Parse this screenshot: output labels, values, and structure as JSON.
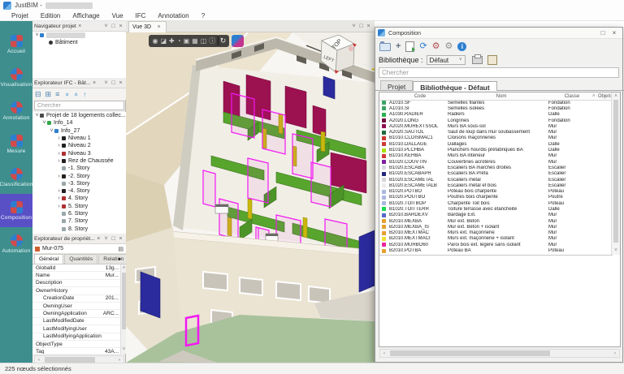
{
  "window": {
    "app_title": "JustBIM -",
    "menu": [
      "Projet",
      "Edition",
      "Affichage",
      "Vue",
      "IFC",
      "Annotation",
      "?"
    ]
  },
  "sidebar": {
    "items": [
      {
        "label": "Accueil",
        "cls": "",
        "icon_cls": ""
      },
      {
        "label": "Visualisation",
        "cls": "",
        "icon_cls": "round"
      },
      {
        "label": "Annotation",
        "cls": "",
        "icon_cls": "round"
      },
      {
        "label": "Mesure",
        "cls": "",
        "icon_cls": ""
      },
      {
        "label": "Classification",
        "cls": "",
        "icon_cls": "round"
      },
      {
        "label": "Composition",
        "cls": "active",
        "icon_cls": ""
      },
      {
        "label": "Automation",
        "cls": "",
        "icon_cls": "round"
      }
    ]
  },
  "navigator": {
    "title": "Navigateur projet",
    "close_glyph": "×",
    "root_chevron": "˅",
    "child_label": "Bâtiment"
  },
  "ifc": {
    "title": "Explorateur IFC - Bât...",
    "search_placeholder": "Chercher",
    "tree": [
      {
        "label": "Projet de 18 logements collec...",
        "cls": "lvl0",
        "chev": "˅",
        "sq": "#4a4a4a"
      },
      {
        "label": "Info_14",
        "cls": "lvl1",
        "chev": "˅",
        "sq": "#35a74a"
      },
      {
        "label": "Info_27",
        "cls": "lvl2",
        "chev": "˅",
        "sq": "#2f7fd0"
      },
      {
        "label": "Niveau 1",
        "cls": "lvl3",
        "chev": "›",
        "sq": "#222222"
      },
      {
        "label": "Niveau 2",
        "cls": "lvl3",
        "chev": "›",
        "sq": "#222222"
      },
      {
        "label": "Niveau 3",
        "cls": "lvl3",
        "chev": "›",
        "sq": "#b03030"
      },
      {
        "label": "Rez de Chaussée",
        "cls": "lvl3",
        "chev": "›",
        "sq": "#222222"
      },
      {
        "label": "-1. Story",
        "cls": "lvl3",
        "chev": "",
        "sq": "#9aa7ad"
      },
      {
        "label": "-2. Story",
        "cls": "lvl3",
        "chev": "›",
        "sq": "#222222"
      },
      {
        "label": "-3. Story",
        "cls": "lvl3",
        "chev": "",
        "sq": "#9aa7ad"
      },
      {
        "label": "-4. Story",
        "cls": "lvl3",
        "chev": "›",
        "sq": "#222222"
      },
      {
        "label": "4. Story",
        "cls": "lvl3",
        "chev": "›",
        "sq": "#b03030"
      },
      {
        "label": "5. Story",
        "cls": "lvl3",
        "chev": "›",
        "sq": "#b03030"
      },
      {
        "label": "6. Story",
        "cls": "lvl3",
        "chev": "",
        "sq": "#9aa7ad"
      },
      {
        "label": "7. Story",
        "cls": "lvl3",
        "chev": "",
        "sq": "#9aa7ad"
      },
      {
        "label": "8. Story",
        "cls": "lvl3",
        "chev": "",
        "sq": "#9aa7ad"
      }
    ]
  },
  "properties": {
    "title": "Explorateur de propriét...",
    "object_label": "Mur-075",
    "tabs": [
      {
        "label": "Général",
        "cls": "active"
      },
      {
        "label": "Quantités",
        "cls": ""
      },
      {
        "label": "Relation",
        "cls": ""
      }
    ],
    "tab_overflow_glyph": "▸",
    "rows": [
      {
        "key": "GlobalId",
        "value": "13g...",
        "cls": ""
      },
      {
        "key": "Name",
        "value": "Mur...",
        "cls": ""
      },
      {
        "key": "Description",
        "value": "",
        "cls": ""
      },
      {
        "key": "OwnerHistory",
        "value": "",
        "cls": ""
      },
      {
        "key": "CreationDate",
        "value": "201...",
        "cls": "ind"
      },
      {
        "key": "OwningUser",
        "value": "",
        "cls": "ind"
      },
      {
        "key": "OwningApplication",
        "value": "ARC...",
        "cls": "ind"
      },
      {
        "key": "LastModifiedDate",
        "value": "",
        "cls": "ind"
      },
      {
        "key": "LastModifyingUser",
        "value": "",
        "cls": "ind"
      },
      {
        "key": "LastModifyingApplication",
        "value": "",
        "cls": "ind"
      },
      {
        "key": "ObjectType",
        "value": "",
        "cls": ""
      },
      {
        "key": "Tag",
        "value": "43A...",
        "cls": ""
      },
      {
        "key": "PredefinedType",
        "value": "",
        "cls": ""
      }
    ]
  },
  "viewport": {
    "tab_label": "Vue 3D",
    "tab_close": "×",
    "toolbar_icons": [
      {
        "name": "record-icon",
        "glyph": "◉"
      },
      {
        "name": "shaded-view-icon",
        "glyph": "◪"
      },
      {
        "name": "pin-icon",
        "glyph": "✚"
      },
      {
        "name": "orbit-mode-icon",
        "glyph": "◔"
      },
      {
        "name": "section-box-icon",
        "glyph": "▣"
      },
      {
        "name": "storeys-icon",
        "glyph": "▦"
      },
      {
        "name": "split-view-icon",
        "glyph": "◫"
      },
      {
        "name": "info-icon",
        "glyph": "ⓘ"
      }
    ],
    "reset_view_glyph": "↻",
    "viewcube": {
      "top": "TOP",
      "left": "LEFT"
    }
  },
  "composition": {
    "title": "Composition",
    "maximize_glyph": "□",
    "close_glyph": "×",
    "add_glyph": "+",
    "sync_glyph": "⟳",
    "gear_glyph": "⚙",
    "info_glyph": "i",
    "library_label": "Bibliothèque :",
    "library_value": "Défaut",
    "dropdown_glyph": "˅",
    "search_placeholder": "Chercher",
    "tabs": [
      {
        "label": "Projet",
        "cls": ""
      },
      {
        "label": "Bibliothèque - Défaut",
        "cls": "active"
      }
    ],
    "columns": [
      "Code",
      "Nom",
      "Classe",
      "Objets"
    ],
    "sort_glyph": "˄",
    "rows": [
      {
        "code": "A1010.SF",
        "nom": "Semelles filantes",
        "classe": "Fondation",
        "objets": "",
        "color": "#3aa562"
      },
      {
        "code": "A1010.SI",
        "nom": "Semelles isolées",
        "classe": "Fondation",
        "objets": "",
        "color": "#3aa562"
      },
      {
        "code": "A1030.RADIER",
        "nom": "Radiers",
        "classe": "Dalle",
        "objets": "",
        "color": "#2eb04e"
      },
      {
        "code": "A2020.LONG",
        "nom": "Longrines",
        "classe": "Fondation",
        "objets": "",
        "color": "#721042"
      },
      {
        "code": "A2020.MUREXTSSOL",
        "nom": "Murs BA sous-sol",
        "classe": "Mur",
        "objets": "",
        "color": "#8e0e52"
      },
      {
        "code": "A2020.SAUTOL",
        "nom": "Saut de loup dans mur soubassement",
        "classe": "Mur",
        "objets": "",
        "color": "#1e6e3e"
      },
      {
        "code": "B1010.CLOISMAC1",
        "nom": "Cloisons maçonneries",
        "classe": "Mur",
        "objets": "",
        "color": "#cf3a34"
      },
      {
        "code": "B1010.DALLAGE",
        "nom": "Dallages",
        "classe": "Dalle",
        "objets": "",
        "color": "#cf3a34"
      },
      {
        "code": "B1010.PLCHBA",
        "nom": "Planchers hourdis préfabriqués BA",
        "classe": "Dalle",
        "objets": "",
        "color": "#a8e000"
      },
      {
        "code": "B1010.KEHBA",
        "nom": "Murs BA intérieur",
        "classe": "Mur",
        "objets": "",
        "color": "#cf3a34"
      },
      {
        "code": "B1020.COUVTIN",
        "nom": "Couvertines acrotères",
        "classe": "Mur",
        "objets": "",
        "color": "#7d1fa0"
      },
      {
        "code": "B1020.ESCABA",
        "nom": "Escaliers BA marches droites",
        "classe": "Escalier",
        "objets": "",
        "color": "#d8d8e4"
      },
      {
        "code": "B1020.ESCABAPR",
        "nom": "Escaliers BA Préfa",
        "classe": "Escalier",
        "objets": "",
        "color": "#232878"
      },
      {
        "code": "B1020.ESCAMETAL",
        "nom": "Escaliers métal",
        "classe": "Escalier",
        "objets": "",
        "color": "#d4d4d4"
      },
      {
        "code": "B1020.ESCAMETALB",
        "nom": "Escaliers métal et bois",
        "classe": "Escalier",
        "objets": "",
        "color": "#ececec"
      },
      {
        "code": "B1020.POTBO",
        "nom": "Poteau bois charpente",
        "classe": "Poteau",
        "objets": "",
        "color": "#aab8e0"
      },
      {
        "code": "B1020.POUTBO",
        "nom": "Poutres bois charpente",
        "classe": "Poutre",
        "objets": "",
        "color": "#aab8e0"
      },
      {
        "code": "B1020.TOITBOP",
        "nom": "Charpente Toit bois",
        "classe": "Poteau",
        "objets": "",
        "color": "#aab8e0"
      },
      {
        "code": "B1020.TOITTERR",
        "nom": "Toiture terrasse avec étanchéité",
        "classe": "Dalle",
        "objets": "",
        "color": "#18dc50"
      },
      {
        "code": "B2010.BARDEXV",
        "nom": "Bardage Ext.",
        "classe": "Mur",
        "objets": "",
        "color": "#5668c8"
      },
      {
        "code": "B2010.MEXBA",
        "nom": "Mur ext. Béton",
        "classe": "Mur",
        "objets": "",
        "color": "#e8a030"
      },
      {
        "code": "B2010.MEXBA_IS",
        "nom": "Mur ext. Béton + isolant",
        "classe": "Mur",
        "objets": "",
        "color": "#e8a030"
      },
      {
        "code": "B2010.MEXTMAC",
        "nom": "Murs ext. maçonnerie",
        "classe": "Mur",
        "objets": "",
        "color": "#e8a030"
      },
      {
        "code": "B2010.MEXTMACI",
        "nom": "Murs ext. maçonnerie + isolant",
        "classe": "Mur",
        "objets": "",
        "color": "#f0e030"
      },
      {
        "code": "B2010.MURBO60",
        "nom": "Paroi bois ext. légère sans isolant",
        "classe": "Mur",
        "objets": "",
        "color": "#e8259c"
      },
      {
        "code": "B2010.POTBA",
        "nom": "Poteau BA",
        "classe": "Poteau",
        "objets": "",
        "color": "#e8a030"
      }
    ]
  },
  "status": {
    "text": "225 nœuds sélectionnés"
  }
}
